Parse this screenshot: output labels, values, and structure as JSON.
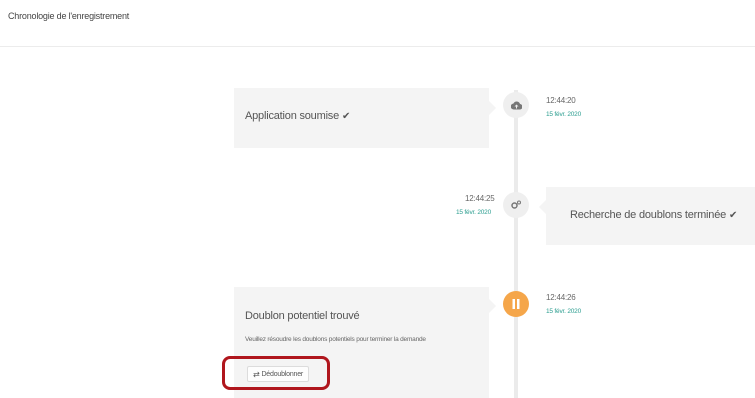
{
  "page": {
    "title": "Chronologie de l'enregistrement"
  },
  "timeline": {
    "events": [
      {
        "title": "Application soumise",
        "check": "✔",
        "time": "12:44:20",
        "date": "15 févr. 2020",
        "icon": "cloud-upload-icon"
      },
      {
        "title": "Recherche de doublons terminée",
        "check": "✔",
        "time": "12:44:25",
        "date": "15 févr. 2020",
        "icon": "gears-icon"
      },
      {
        "title": "Doublon potentiel trouvé",
        "description": "Veuillez résoudre les doublons potentiels pour terminer la demande",
        "time": "12:44:26",
        "date": "15 févr. 2020",
        "icon": "pause-icon",
        "button_icon": "⇄",
        "button_label": "Dédoublonner"
      }
    ]
  },
  "colors": {
    "date": "#2a9d8f",
    "pause_marker": "#f5a64a",
    "highlight": "#b0161d",
    "card": "#f4f4f4"
  }
}
